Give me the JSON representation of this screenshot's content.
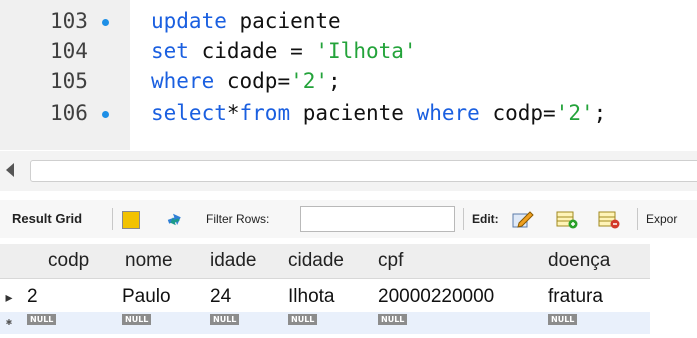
{
  "editor": {
    "lines": [
      {
        "number": "103",
        "marker": true,
        "tokens": [
          [
            "kw",
            "update"
          ],
          [
            "op",
            " "
          ],
          [
            "id",
            "paciente"
          ]
        ]
      },
      {
        "number": "104",
        "marker": false,
        "tokens": [
          [
            "kw",
            "set"
          ],
          [
            "op",
            " "
          ],
          [
            "id",
            "cidade"
          ],
          [
            "op",
            " = "
          ],
          [
            "str",
            "'Ilhota'"
          ]
        ]
      },
      {
        "number": "105",
        "marker": false,
        "tokens": [
          [
            "kw",
            "where"
          ],
          [
            "op",
            " "
          ],
          [
            "id",
            "codp"
          ],
          [
            "op",
            "="
          ],
          [
            "str",
            "'2'"
          ],
          [
            "op",
            ";"
          ]
        ]
      },
      {
        "number": "106",
        "marker": true,
        "tokens": [
          [
            "kw",
            "select"
          ],
          [
            "op",
            "*"
          ],
          [
            "kw",
            "from"
          ],
          [
            "op",
            " "
          ],
          [
            "id",
            "paciente"
          ],
          [
            "op",
            " "
          ],
          [
            "kw",
            "where"
          ],
          [
            "op",
            " "
          ],
          [
            "id",
            "codp"
          ],
          [
            "op",
            "="
          ],
          [
            "str",
            "'2'"
          ],
          [
            "op",
            ";"
          ]
        ]
      }
    ]
  },
  "toolbar": {
    "result_grid_label": "Result Grid",
    "filter_rows_label": "Filter Rows:",
    "filter_value": "",
    "edit_label": "Edit:",
    "export_label": "Expor"
  },
  "grid": {
    "columns": [
      "codp",
      "nome",
      "idade",
      "cidade",
      "cpf",
      "doença"
    ],
    "rows": [
      [
        "2",
        "Paulo",
        "24",
        "Ilhota",
        "20000220000",
        "fratura"
      ]
    ],
    "null_label": "NULL",
    "current_row_marker": "▸",
    "new_row_marker": "✱"
  },
  "colors": {
    "keyword": "#1a5fe0",
    "string": "#23a33a",
    "marker_dot": "#1e8fe6",
    "null_badge": "#8c8c8c"
  }
}
